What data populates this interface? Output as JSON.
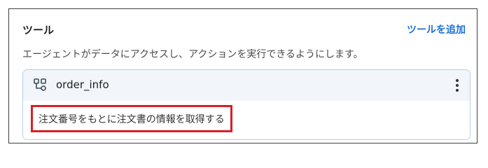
{
  "section": {
    "title": "ツール",
    "add_label": "ツールを追加",
    "description": "エージェントがデータにアクセスし、アクションを実行できるようにします。"
  },
  "tool": {
    "icon": "tool-flow-icon",
    "name": "order_info",
    "menu_icon": "more-vertical-icon",
    "description": "注文番号をもとに注文書の情報を取得する"
  },
  "colors": {
    "accent": "#1a6fd6",
    "highlight_border": "#d81f26",
    "card_border": "#b9cdea"
  }
}
